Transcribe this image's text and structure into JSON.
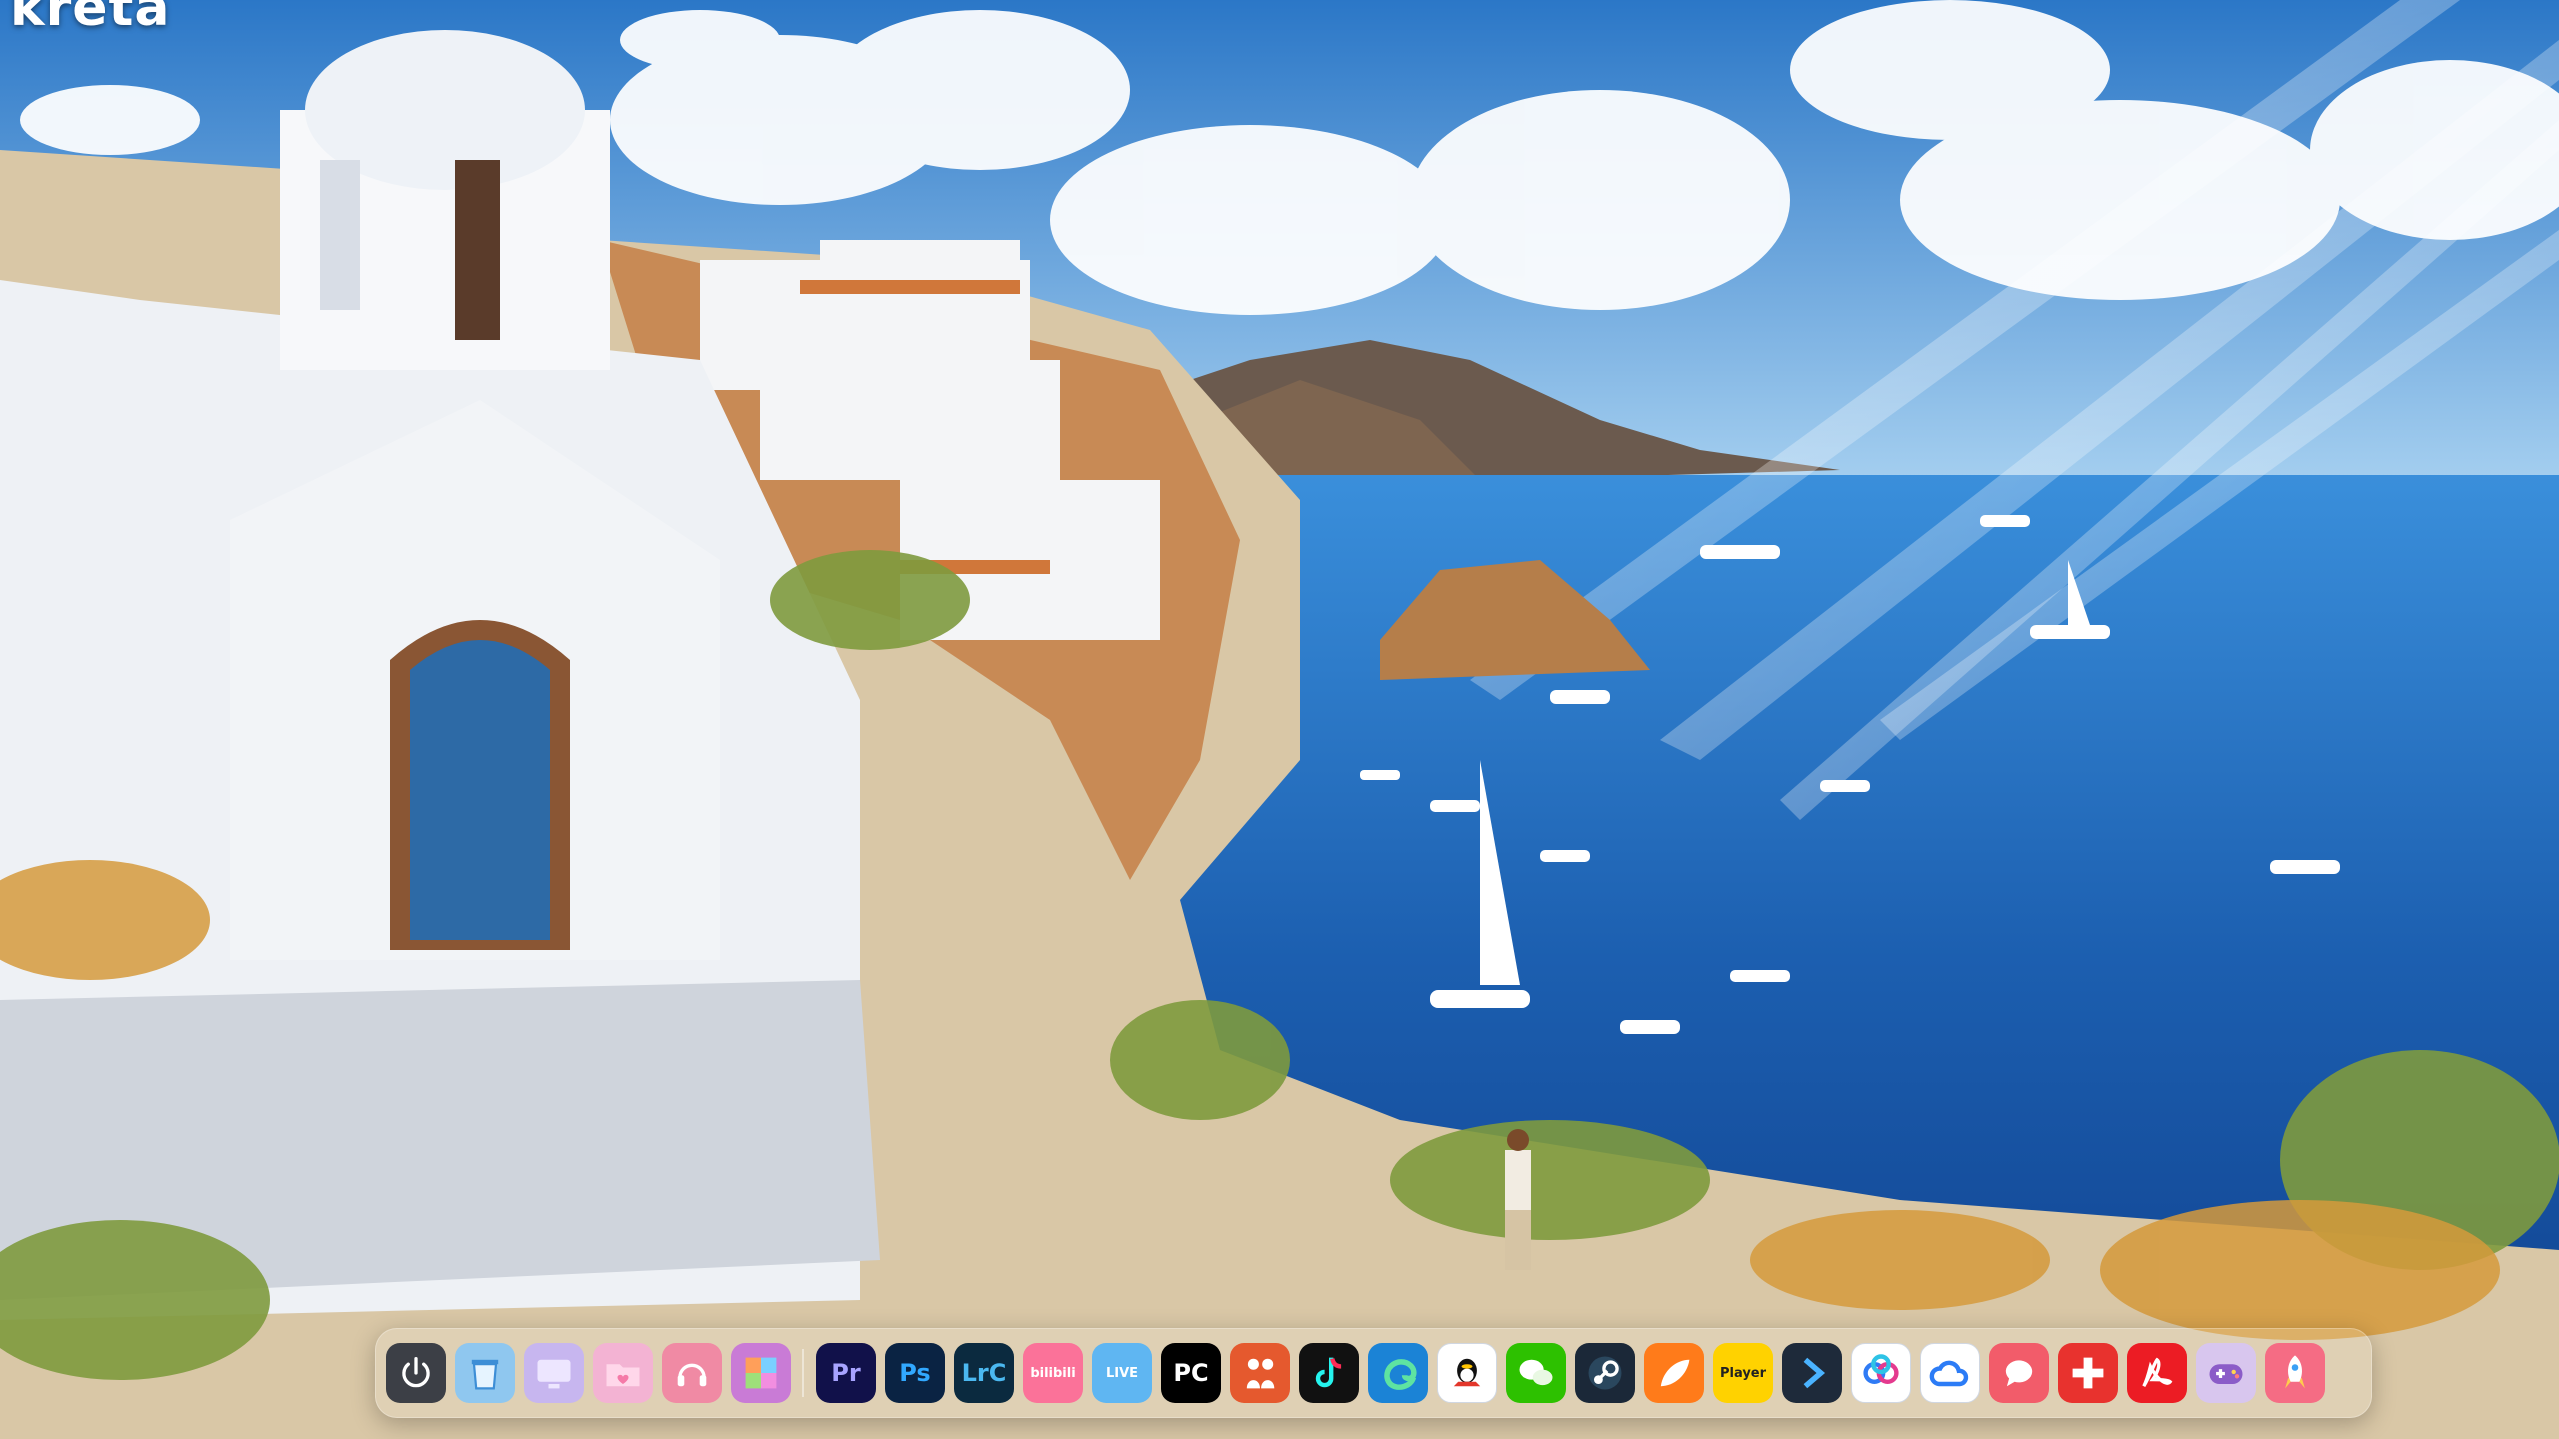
{
  "desktop": {
    "watermark": "kreta",
    "dock": {
      "items": [
        {
          "name": "power",
          "label": "",
          "color": "#3c3f46"
        },
        {
          "name": "recycle-bin",
          "label": "",
          "color": "#8fc7ef"
        },
        {
          "name": "monitor",
          "label": "",
          "color": "#c7b6ef"
        },
        {
          "name": "folder",
          "label": "",
          "color": "#f3b3d3"
        },
        {
          "name": "headphones",
          "label": "",
          "color": "#f08aa4"
        },
        {
          "name": "photos",
          "label": "",
          "color": "#c97bd6"
        },
        {
          "name": "premiere-pro",
          "label": "Pr",
          "color": "#11114a",
          "text": "#a8a4ff"
        },
        {
          "name": "photoshop",
          "label": "Ps",
          "color": "#0a2343",
          "text": "#31a8ff"
        },
        {
          "name": "lightroom-classic",
          "label": "LrC",
          "color": "#0b2a3f",
          "text": "#4bb8f0"
        },
        {
          "name": "bilibili",
          "label": "bilibili",
          "color": "#fb7299"
        },
        {
          "name": "live-app",
          "label": "LIVE",
          "color": "#5fb6f2"
        },
        {
          "name": "pycharm",
          "label": "PC",
          "color": "#000000"
        },
        {
          "name": "people-app",
          "label": "",
          "color": "#e5592e"
        },
        {
          "name": "tiktok",
          "label": "",
          "color": "#111111"
        },
        {
          "name": "edge",
          "label": "",
          "color": "#1b83d6"
        },
        {
          "name": "qq",
          "label": "",
          "color": "#ffffff"
        },
        {
          "name": "wechat",
          "label": "",
          "color": "#2dc100"
        },
        {
          "name": "steam",
          "label": "",
          "color": "#1b2838"
        },
        {
          "name": "orange-app",
          "label": "",
          "color": "#ff7b1a"
        },
        {
          "name": "potplayer",
          "label": "Player",
          "color": "#ffd200",
          "text": "#222222"
        },
        {
          "name": "arrow-app",
          "label": "",
          "color": "#1e2a3a"
        },
        {
          "name": "baidu-netdisk",
          "label": "",
          "color": "#ffffff"
        },
        {
          "name": "cloud-app",
          "label": "",
          "color": "#ffffff"
        },
        {
          "name": "chat-bubble-app",
          "label": "",
          "color": "#f25c6a"
        },
        {
          "name": "red-cross-app",
          "label": "",
          "color": "#e8322e"
        },
        {
          "name": "acrobat",
          "label": "",
          "color": "#ec1c24"
        },
        {
          "name": "game-controller",
          "label": "",
          "color": "#d8c6ee"
        },
        {
          "name": "rocket",
          "label": "",
          "color": "#f56c84"
        }
      ]
    }
  }
}
